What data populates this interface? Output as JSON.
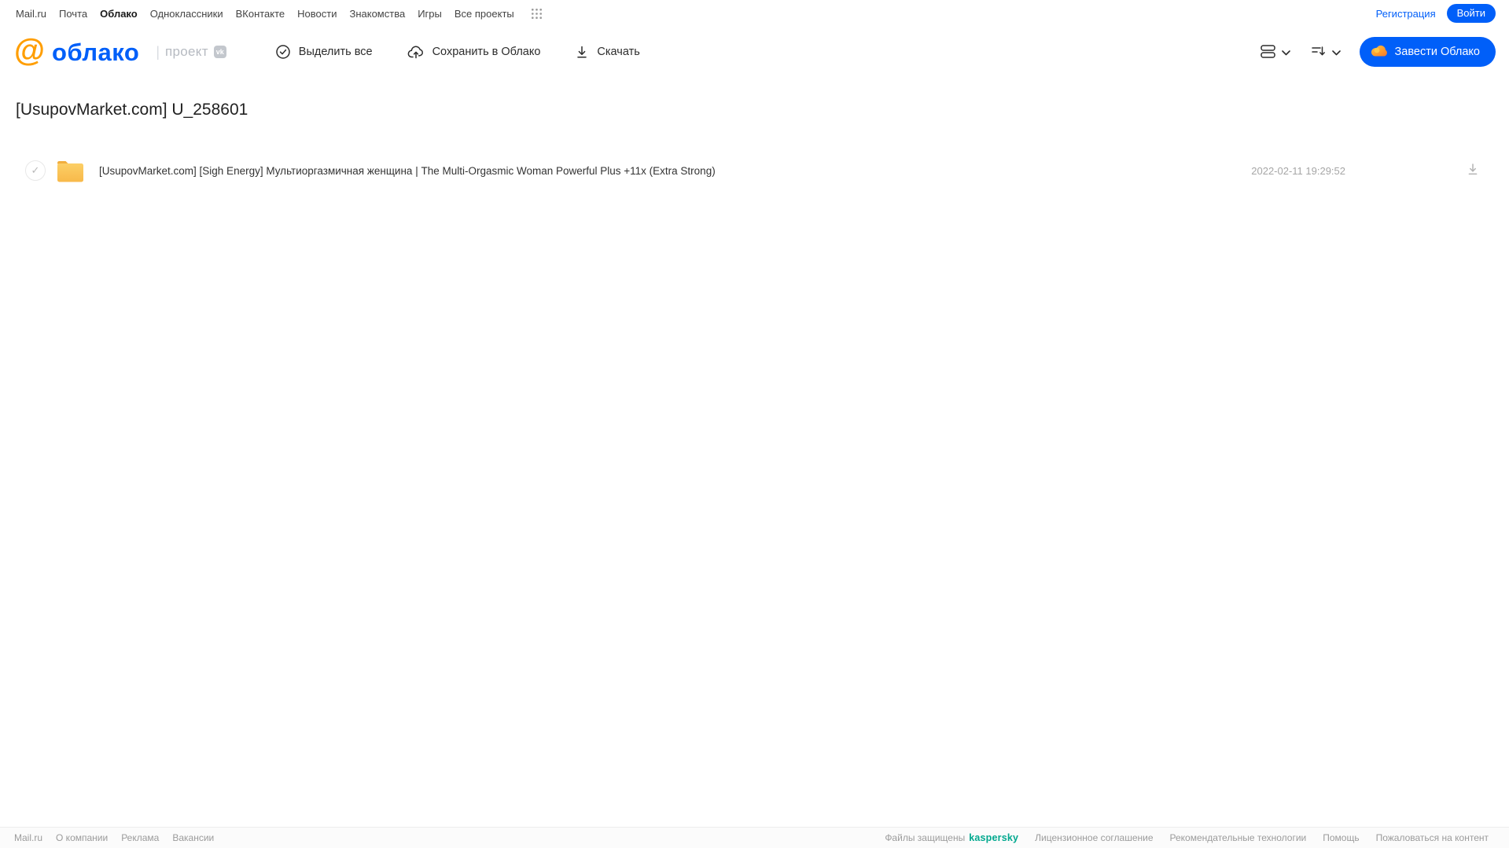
{
  "topnav": {
    "items": [
      {
        "label": "Mail.ru",
        "active": false
      },
      {
        "label": "Почта",
        "active": false
      },
      {
        "label": "Облако",
        "active": true
      },
      {
        "label": "Одноклассники",
        "active": false
      },
      {
        "label": "ВКонтакте",
        "active": false
      },
      {
        "label": "Новости",
        "active": false
      },
      {
        "label": "Знакомства",
        "active": false
      },
      {
        "label": "Игры",
        "active": false
      },
      {
        "label": "Все проекты",
        "active": false
      }
    ],
    "registration_label": "Регистрация",
    "login_label": "Войти"
  },
  "header": {
    "logo_at": "@",
    "logo_text": "облако",
    "project_divider": "|",
    "project_label": "проект",
    "vk_badge": "vk",
    "toolbar": {
      "select_all_label": "Выделить все",
      "save_to_cloud_label": "Сохранить в Облако",
      "download_label": "Скачать"
    },
    "get_cloud_label": "Завести Облако"
  },
  "page": {
    "title": "[UsupovMarket.com] U_258601"
  },
  "file_list": {
    "rows": [
      {
        "type": "folder",
        "name": "[UsupovMarket.com] [Sigh Energy] Мультиоргазмичная женщина | The Multi-Orgasmic Woman Powerful Plus +11x (Extra Strong)",
        "date": "2022-02-11 19:29:52",
        "check_glyph": "✓"
      }
    ]
  },
  "footer": {
    "left_links": [
      "Mail.ru",
      "О компании",
      "Реклама",
      "Вакансии"
    ],
    "protected_text": "Файлы защищены",
    "kaspersky_label": "kaspersky",
    "right_links": [
      "Лицензионное соглашение",
      "Рекомендательные технологии",
      "Помощь",
      "Пожаловаться на контент"
    ]
  },
  "icons": {
    "apps_grid": "grid-of-dots",
    "select_all": "check-circle",
    "save_to_cloud": "cloud-with-up-arrow",
    "download": "arrow-down-to-line",
    "view_mode": "stacked-rows",
    "sort": "sort-lines-with-arrow",
    "chevron": "chevron-down",
    "cloud_badge": "orange-cloud",
    "folder": "yellow-folder"
  },
  "colors": {
    "accent_blue": "#005ff9",
    "logo_orange": "#ff9e00",
    "folder_yellow": "#fcc453",
    "kaspersky_green": "#00a88e",
    "muted_gray": "#9b9b9b"
  }
}
